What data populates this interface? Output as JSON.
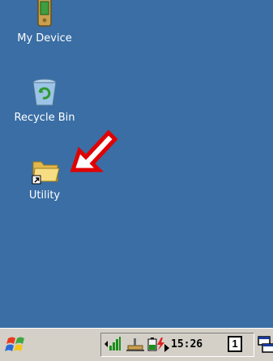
{
  "desktop": {
    "background": "#3a6ea5",
    "icons": [
      {
        "label": "My Device",
        "icon": "pda-icon"
      },
      {
        "label": "Recycle Bin",
        "icon": "recycle-bin-icon"
      },
      {
        "label": "Utility",
        "icon": "folder-shortcut-icon"
      }
    ],
    "annotation": {
      "icon": "red-arrow-icon",
      "color": "#e00000"
    }
  },
  "taskbar": {
    "start_icon": "windows-flag-icon",
    "tray_icons": [
      "signal-strength-icon",
      "network-icon",
      "battery-charging-icon",
      "expand-tray-icon"
    ],
    "time": "15:26",
    "desktop_number": "1",
    "switch_icon": "window-switch-icon"
  }
}
